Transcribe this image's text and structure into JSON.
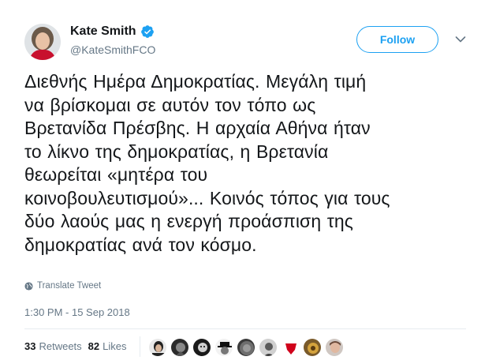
{
  "author": {
    "display_name": "Kate Smith",
    "handle": "@KateSmithFCO",
    "verified_color": "#1da1f2"
  },
  "follow_label": "Follow",
  "tweet": {
    "lines": [
      "Διεθνής Ημέρα Δημοκρατίας. Μεγάλη τιμή",
      "να βρίσκομαι σε αυτόν τον τόπο ως",
      "Βρετανίδα Πρέσβης. Η αρχαία Αθήνα ήταν",
      "το λίκνο της δημοκρατίας, η Βρετανία",
      "θεωρείται «μητέρα του",
      "κοινοβουλευτισμού»... Κοινός τόπος για τους",
      "δύο λαούς μας η ενεργή προάσπιση της",
      "δημοκρατίας ανά τον κόσμο."
    ]
  },
  "translate_label": "Translate Tweet",
  "timestamp": "1:30 PM - 15 Sep 2018",
  "stats": {
    "retweets_count": "33",
    "retweets_label": "Retweets",
    "likes_count": "82",
    "likes_label": "Likes"
  },
  "likers_count": 9,
  "colors": {
    "accent": "#1da1f2",
    "muted": "#657786",
    "text": "#14171a"
  }
}
